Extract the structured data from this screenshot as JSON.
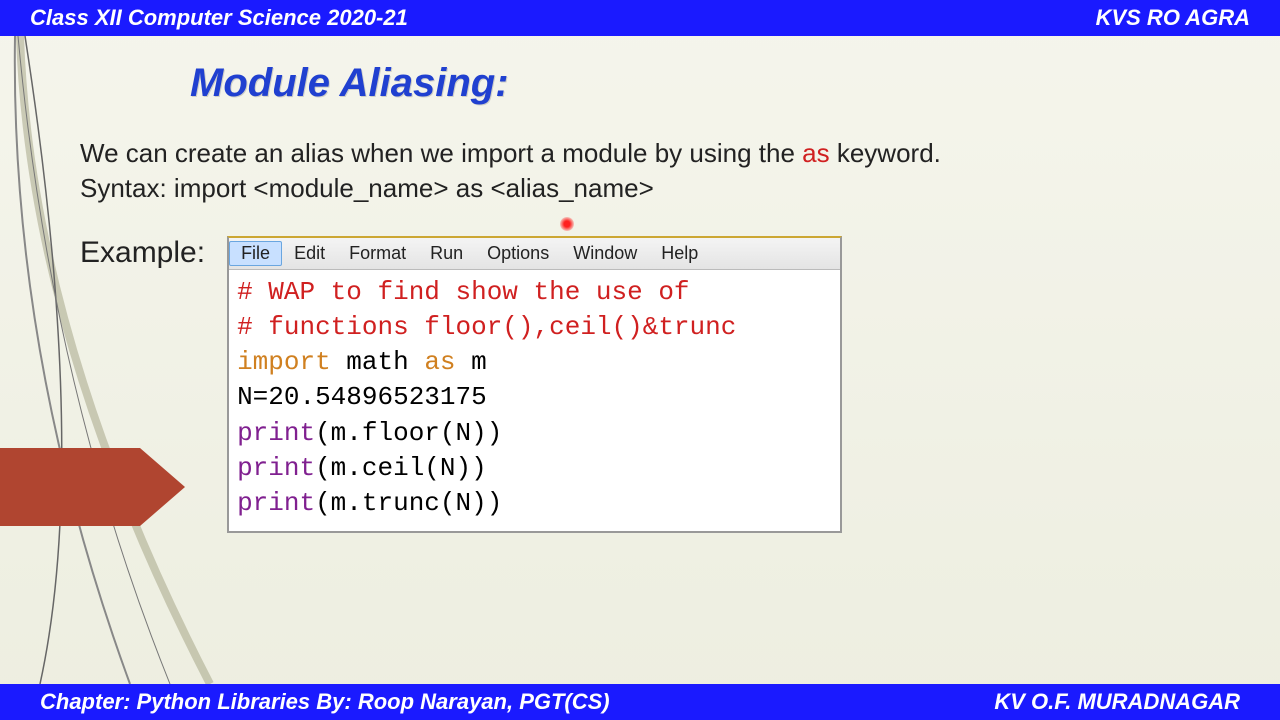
{
  "header": {
    "left": "Class XII Computer Science 2020-21",
    "right": "KVS  RO  AGRA"
  },
  "footer": {
    "left": "Chapter:  Python Libraries     By:  Roop Narayan, PGT(CS)",
    "right": "KV O.F. MURADNAGAR"
  },
  "slide": {
    "title": "Module Aliasing:",
    "line1_pre": "We can create an alias when we import a module by using the ",
    "line1_kw": "as",
    "line1_post": " keyword.",
    "line2": "Syntax: import <module_name> as <alias_name>",
    "example_label": "Example:"
  },
  "idle": {
    "menu": [
      "File",
      "Edit",
      "Format",
      "Run",
      "Options",
      "Window",
      "Help"
    ],
    "code": {
      "c1": "# WAP to find show the use of",
      "c2": "# functions floor(),ceil()&trunc",
      "kw_import": "import",
      "mod": " math ",
      "kw_as": "as",
      "alias": " m",
      "nline": "N=20.54896523175",
      "p": "print",
      "p1arg": "(m.floor(N))",
      "p2arg": "(m.ceil(N))",
      "p3arg": "(m.trunc(N))"
    }
  }
}
